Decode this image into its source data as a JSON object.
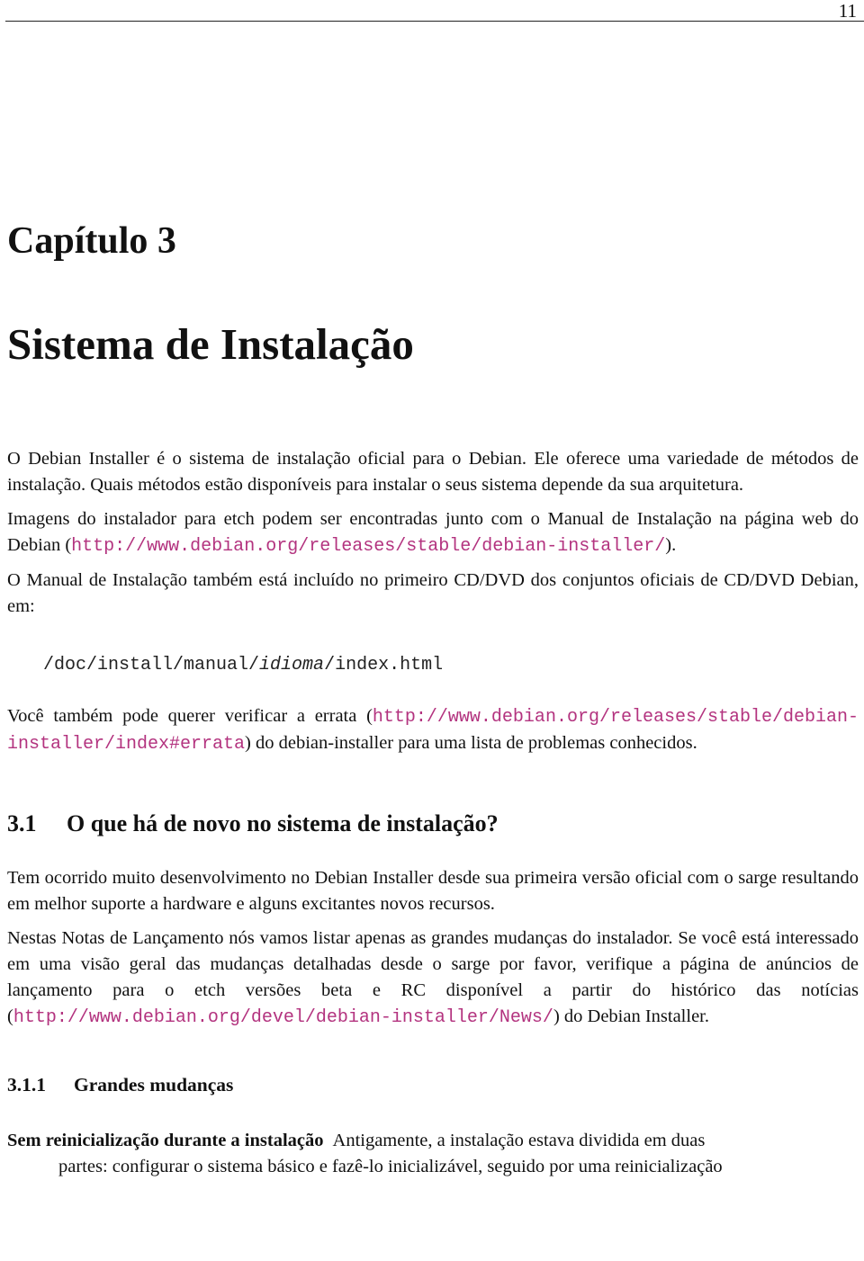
{
  "header": {
    "page_number": "11"
  },
  "chapter": {
    "label": "Capítulo 3",
    "title": "Sistema de Instalação"
  },
  "paragraphs": {
    "p1": "O Debian Installer é o sistema de instalação oficial para o Debian. Ele oferece uma variedade de métodos de instalação. Quais métodos estão disponíveis para instalar o seus sistema depende da sua arquitetura.",
    "p2_before": "Imagens do instalador para etch podem ser encontradas junto com o Manual de Instalação na página web do Debian (",
    "p2_link": "http://www.debian.org/releases/stable/debian-installer/",
    "p2_after": ").",
    "p3": "O Manual de Instalação também está incluído no primeiro CD/DVD dos conjuntos oficiais de CD/DVD Debian, em:",
    "code_prefix": "/doc/install/manual/",
    "code_italic": "idioma",
    "code_suffix": "/index.html",
    "p4_before": "Você também pode querer verificar a errata (",
    "p4_link": "http://www.debian.org/releases/stable/debian-installer/index#errata",
    "p4_after": ") do debian-installer para uma lista de problemas conhecidos."
  },
  "section_3_1": {
    "number": "3.1",
    "title": "O que há de novo no sistema de instalação?",
    "p1": "Tem ocorrido muito desenvolvimento no Debian Installer desde sua primeira versão oficial com o sarge resultando em melhor suporte a hardware e alguns excitantes novos recursos.",
    "p2_before": "Nestas Notas de Lançamento nós vamos listar apenas as grandes mudanças do instalador. Se você está interessado em uma visão geral das mudanças detalhadas desde o sarge por favor, verifique a página de anúncios de lançamento para o etch versões beta e RC disponível a partir do histórico das notícias (",
    "p2_link": "http://www.debian.org/devel/debian-installer/News/",
    "p2_after": ") do Debian Installer."
  },
  "section_3_1_1": {
    "number": "3.1.1",
    "title": "Grandes mudanças",
    "items": [
      {
        "term": "Sem reinicialização durante a instalação",
        "desc_line1": "Antigamente, a instalação estava dividida em duas",
        "desc_line2": "partes: configurar o sistema básico e fazê-lo inicializável, seguido por uma reinicialização"
      }
    ]
  },
  "colors": {
    "link": "#b3337f",
    "text": "#111111"
  }
}
